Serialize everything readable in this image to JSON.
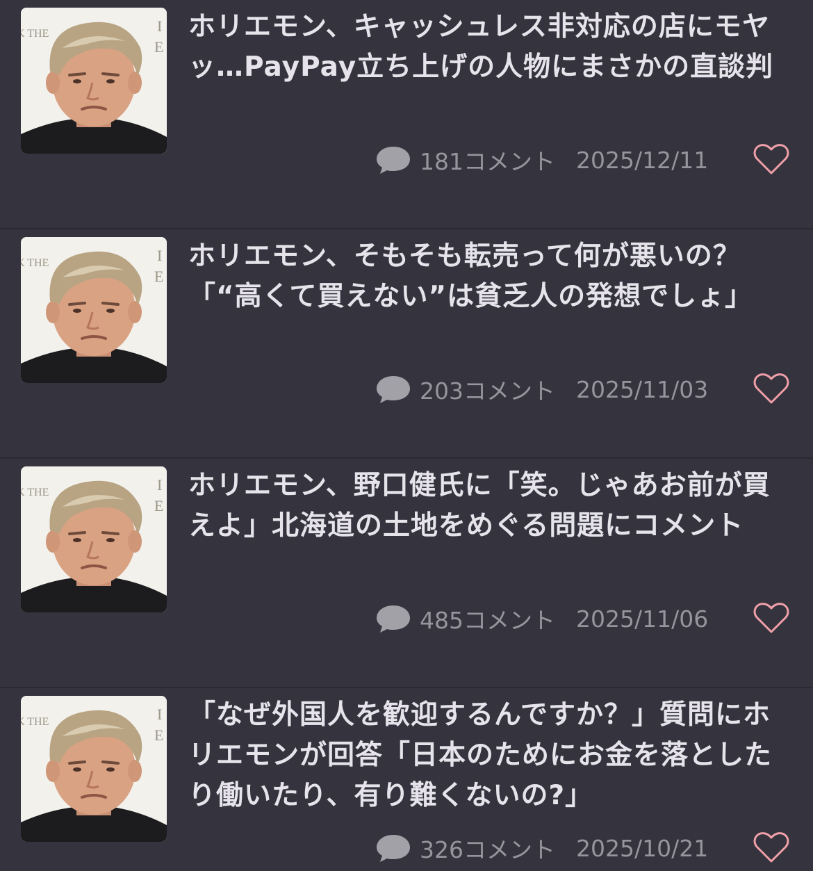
{
  "colors": {
    "background": "#34333e",
    "title_text": "#e6e4ea",
    "meta_text": "#96949c",
    "comment_icon": "#a3a1a8",
    "heart_outline": "#f0a0a8",
    "divider": "#2b2a33"
  },
  "articles": [
    {
      "title": "ホリエモン、キャッシュレス非対応の店にモヤッ…PayPay立ち上げの人物にまさかの直談判",
      "comment_count": "181コメント",
      "date": "2025/12/11",
      "thumbnail_icon": "person-photo",
      "favorite_icon": "heart-outline-icon"
    },
    {
      "title": "ホリエモン、そもそも転売って何が悪いの？「“高くて買えない”は貧乏人の発想でしょ」",
      "comment_count": "203コメント",
      "date": "2025/11/03",
      "thumbnail_icon": "person-photo",
      "favorite_icon": "heart-outline-icon"
    },
    {
      "title": "ホリエモン、野口健氏に「笑。じゃあお前が買えよ」北海道の土地をめぐる問題にコメント",
      "comment_count": "485コメント",
      "date": "2025/11/06",
      "thumbnail_icon": "person-photo",
      "favorite_icon": "heart-outline-icon"
    },
    {
      "title": "「なぜ外国人を歓迎するんですか？」質問にホリエモンが回答「日本のためにお金を落としたり働いたり、有り難くないの?」",
      "comment_count": "326コメント",
      "date": "2025/10/21",
      "thumbnail_icon": "person-photo",
      "favorite_icon": "heart-outline-icon"
    }
  ]
}
